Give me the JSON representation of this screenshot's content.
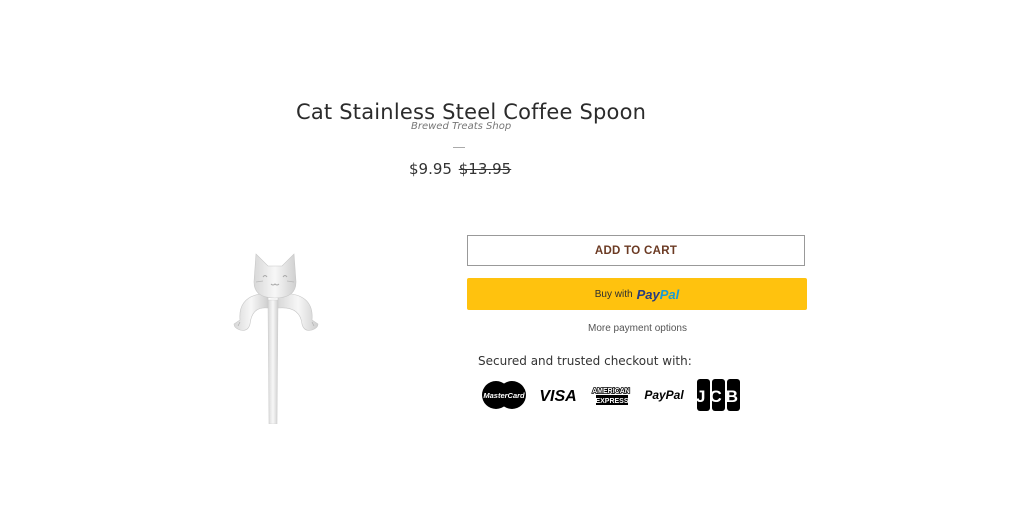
{
  "product": {
    "title": "Cat Stainless Steel Coffee Spoon",
    "vendor": "Brewed Treats Shop",
    "price": "$9.95",
    "compare_price": "$13.95"
  },
  "buttons": {
    "add_to_cart": "ADD TO CART",
    "paypal_prefix": "Buy with",
    "paypal_logo_a": "Pay",
    "paypal_logo_b": "Pal",
    "more_payment": "More payment options"
  },
  "checkout": {
    "secured_text": "Secured and trusted checkout with:",
    "badges": {
      "mastercard": "MasterCard",
      "visa": "VISA",
      "amex_line1": "AMERICAN",
      "amex_line2": "EXPRESS",
      "paypal": "PayPal",
      "jcb": "JCB"
    }
  },
  "colors": {
    "paypal_button": "#ffc20e",
    "add_to_cart_text": "#6b3a23"
  },
  "icons": [
    "mastercard-icon",
    "visa-icon",
    "amex-icon",
    "paypal-icon",
    "jcb-icon"
  ]
}
